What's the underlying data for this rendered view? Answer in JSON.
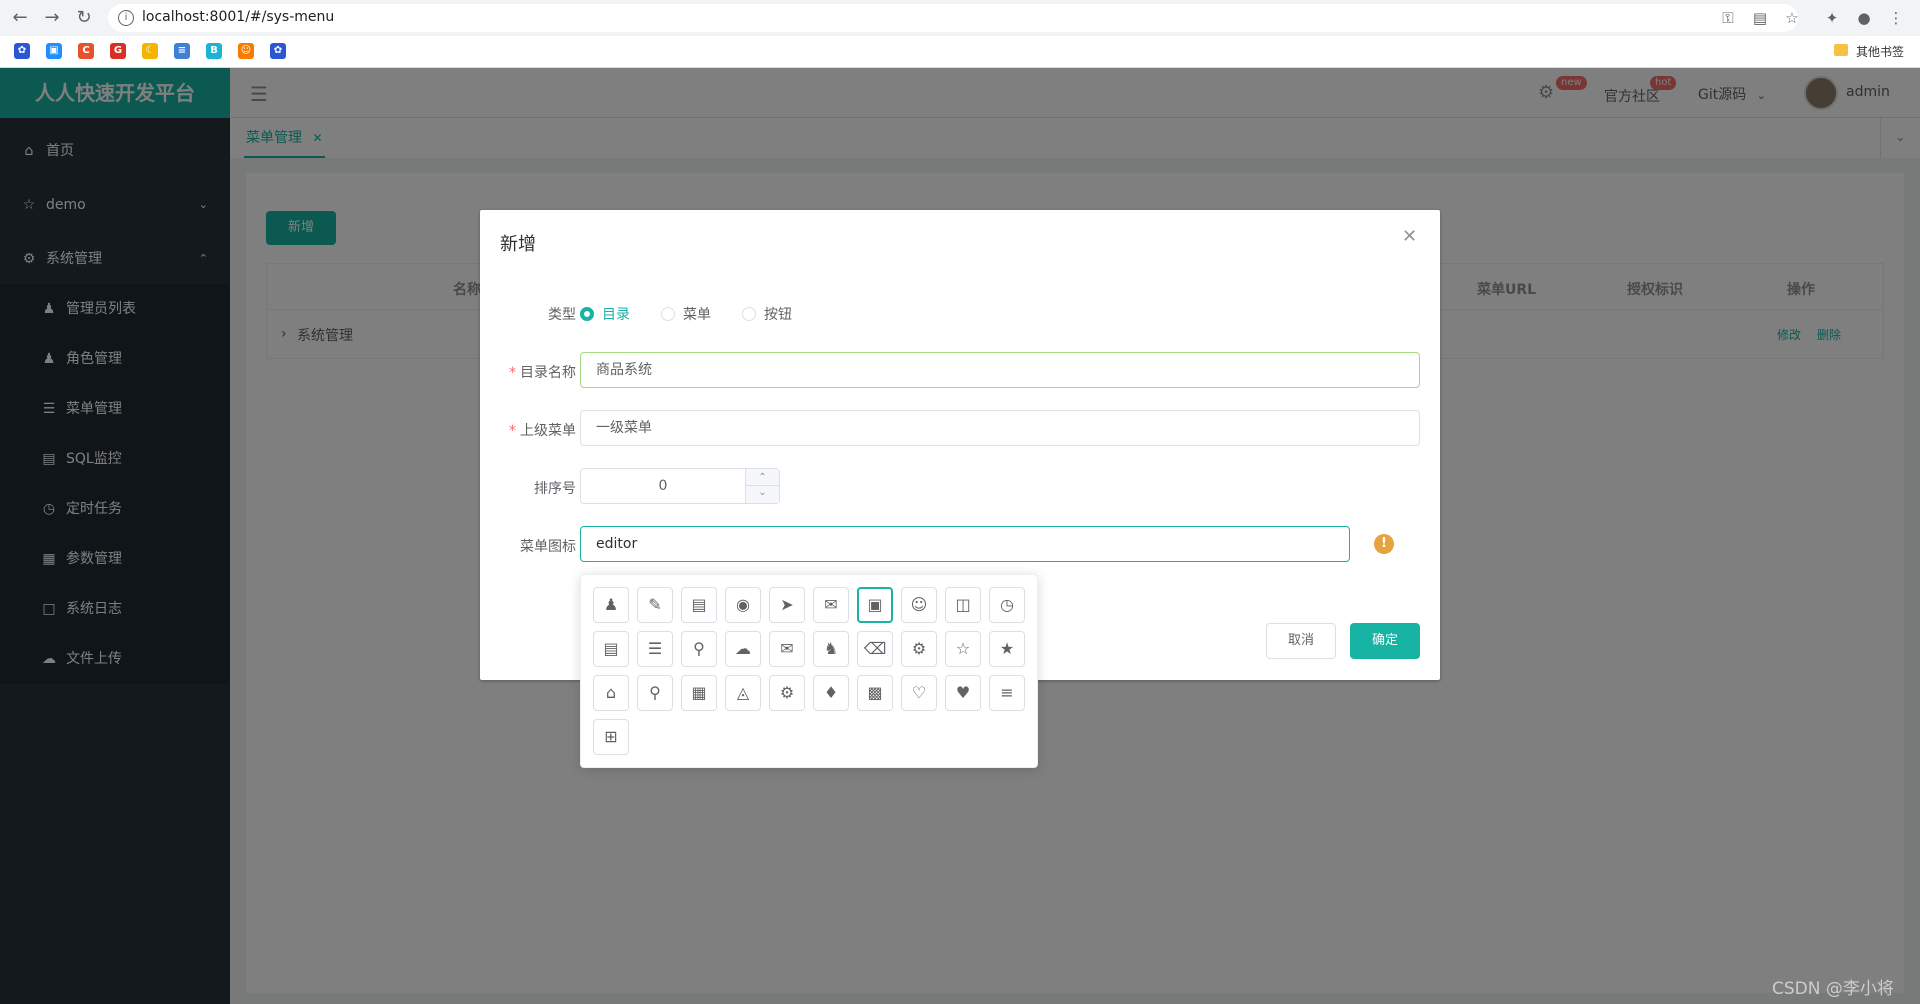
{
  "browser": {
    "url": "localhost:8001/#/sys-menu",
    "bookmarks_folder": "其他书签"
  },
  "app": {
    "logo": "人人快速开发平台",
    "header": {
      "official_community": "官方社区",
      "badge_new": "new",
      "badge_hot": "hot",
      "git_source": "Git源码",
      "user": "admin"
    },
    "sidebar": {
      "items": [
        {
          "label": "首页",
          "icon": "home-icon"
        },
        {
          "label": "demo",
          "icon": "star-icon"
        },
        {
          "label": "系统管理",
          "icon": "gear-icon"
        }
      ],
      "sub_items": [
        {
          "label": "管理员列表",
          "icon": "user-icon"
        },
        {
          "label": "角色管理",
          "icon": "role-icon"
        },
        {
          "label": "菜单管理",
          "icon": "list-icon"
        },
        {
          "label": "SQL监控",
          "icon": "database-icon"
        },
        {
          "label": "定时任务",
          "icon": "clock-icon"
        },
        {
          "label": "参数管理",
          "icon": "config-icon"
        },
        {
          "label": "系统日志",
          "icon": "log-icon"
        },
        {
          "label": "文件上传",
          "icon": "cloud-icon"
        }
      ]
    },
    "tabs": [
      {
        "label": "菜单管理"
      }
    ],
    "toolbar": {
      "add_label": "新增"
    },
    "table": {
      "headers": [
        "名称",
        "菜单URL",
        "授权标识",
        "操作"
      ],
      "rows": [
        {
          "name": "系统管理",
          "edit": "修改",
          "delete": "删除"
        }
      ]
    }
  },
  "dialog": {
    "title": "新增",
    "type_label": "类型",
    "type_options": [
      "目录",
      "菜单",
      "按钮"
    ],
    "type_selected": "目录",
    "name_label": "目录名称",
    "name_value": "商品系统",
    "parent_label": "上级菜单",
    "parent_value": "一级菜单",
    "order_label": "排序号",
    "order_value": "0",
    "icon_label": "菜单图标",
    "icon_value": "editor",
    "cancel_label": "取消",
    "confirm_label": "确定",
    "icon_grid": [
      "user-icon",
      "edit-icon",
      "document-icon",
      "location-icon",
      "send-icon",
      "mail-icon",
      "image-icon",
      "avatar-icon",
      "lock-icon",
      "clock-icon",
      "file-icon",
      "list-icon",
      "pin-icon",
      "cloud-icon",
      "message-icon",
      "admin-icon",
      "trash-icon",
      "gear-icon",
      "star-icon",
      "star-filled-icon",
      "home-icon",
      "search-icon",
      "calculator-icon",
      "unlock-icon",
      "settings-icon",
      "bell-icon",
      "chart-icon",
      "heart-icon",
      "heart-filled-icon",
      "menu-icon",
      "grid-icon"
    ],
    "icon_selected": "image-icon"
  },
  "watermark": "CSDN @李小将",
  "colors": {
    "primary": "#17b3a3",
    "sidebar": "#263238",
    "warning": "#e6a23c",
    "danger": "#f56c6c"
  }
}
